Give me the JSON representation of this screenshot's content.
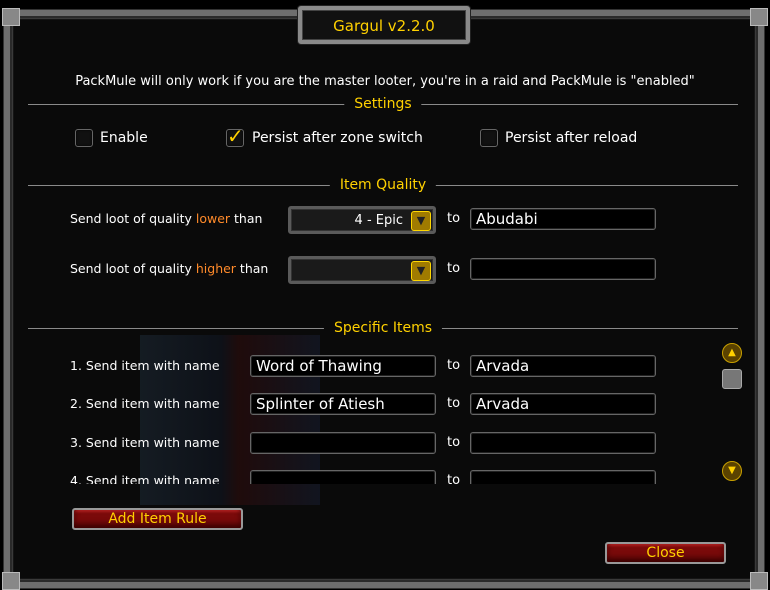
{
  "window": {
    "title": "Gargul v2.2.0"
  },
  "info_text": "PackMule will only work if you are the master looter, you're in a raid and PackMule is \"enabled\"",
  "settings": {
    "heading": "Settings",
    "enable": {
      "label": "Enable",
      "checked": false
    },
    "persist_zone": {
      "label": "Persist after zone switch",
      "checked": true
    },
    "persist_reload": {
      "label": "Persist after reload",
      "checked": false
    }
  },
  "item_quality": {
    "heading": "Item Quality",
    "lower": {
      "prefix": "Send loot of quality ",
      "highlight": "lower",
      "suffix": " than",
      "dropdown_value": "4 - Epic",
      "to": "to",
      "target": "Abudabi"
    },
    "higher": {
      "prefix": "Send loot of quality ",
      "highlight": "higher",
      "suffix": " than",
      "dropdown_value": "",
      "to": "to",
      "target": ""
    }
  },
  "specific_items": {
    "heading": "Specific Items",
    "rows": [
      {
        "label": "1. Send item with name",
        "item": "Word of Thawing",
        "to": "to",
        "target": "Arvada"
      },
      {
        "label": "2. Send item with name",
        "item": "Splinter of Atiesh",
        "to": "to",
        "target": "Arvada"
      },
      {
        "label": "3. Send item with name",
        "item": "",
        "to": "to",
        "target": ""
      },
      {
        "label": "4. Send item with name",
        "item": "",
        "to": "to",
        "target": ""
      }
    ]
  },
  "buttons": {
    "add_rule": "Add Item Rule",
    "close": "Close"
  },
  "colors": {
    "gold": "#ffd100",
    "highlight": "#ff8a2a",
    "button_red": "#7a0a0a"
  }
}
